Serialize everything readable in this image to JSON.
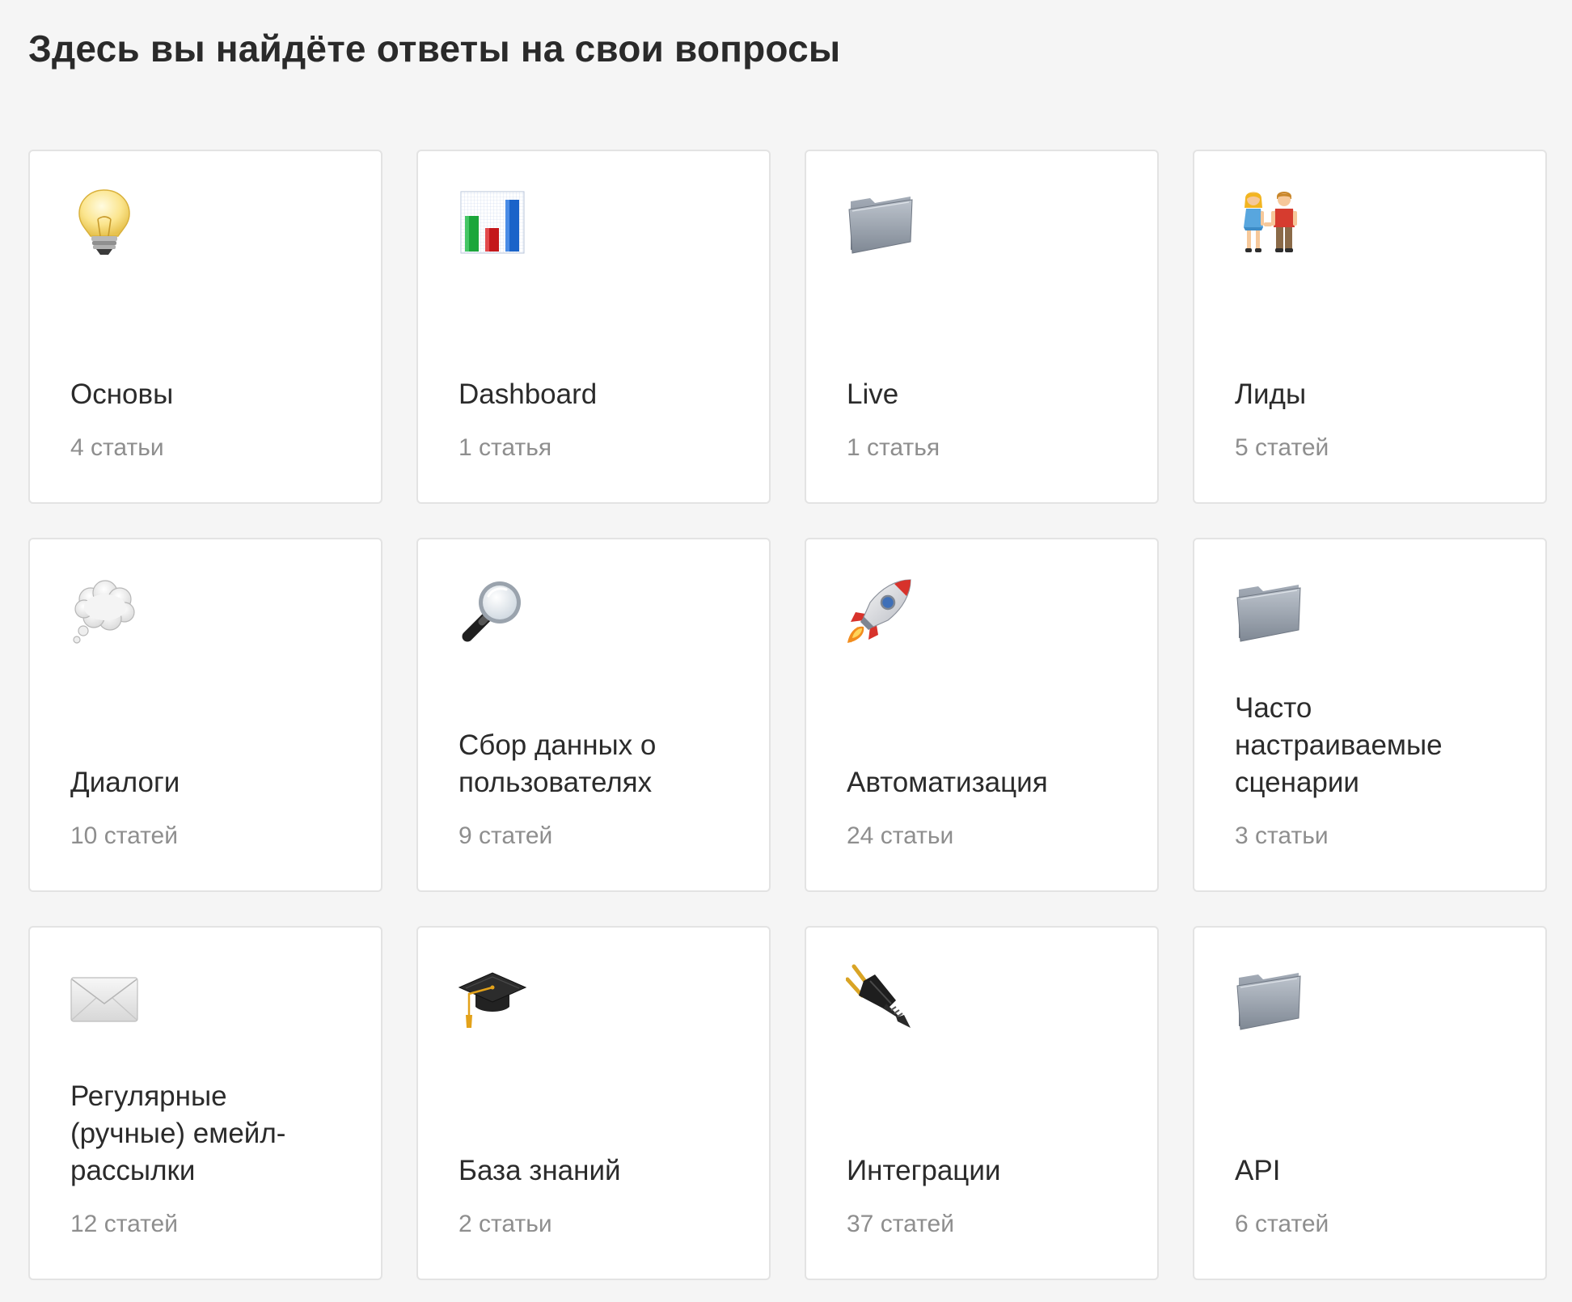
{
  "header": {
    "title": "Здесь вы найдёте ответы на свои вопросы"
  },
  "categories": [
    {
      "icon": "lightbulb-icon",
      "title": "Основы",
      "count": "4 статьи"
    },
    {
      "icon": "bar-chart-icon",
      "title": "Dashboard",
      "count": "1 статья"
    },
    {
      "icon": "folder-icon",
      "title": "Live",
      "count": "1 статья"
    },
    {
      "icon": "couple-icon",
      "title": "Лиды",
      "count": "5 статей"
    },
    {
      "icon": "thought-bubble-icon",
      "title": "Диалоги",
      "count": "10 статей"
    },
    {
      "icon": "magnifier-icon",
      "title": "Сбор данных о пользователях",
      "count": "9 статей"
    },
    {
      "icon": "rocket-icon",
      "title": "Автоматизация",
      "count": "24 статьи"
    },
    {
      "icon": "folder-icon",
      "title": "Часто настраиваемые сценарии",
      "count": "3 статьи"
    },
    {
      "icon": "envelope-icon",
      "title": "Регулярные (ручные) емейл-рассылки",
      "count": "12 статей"
    },
    {
      "icon": "graduation-cap-icon",
      "title": "База знаний",
      "count": "2 статьи"
    },
    {
      "icon": "plug-icon",
      "title": "Интеграции",
      "count": "37 статей"
    },
    {
      "icon": "folder-icon",
      "title": "API",
      "count": "6 статей"
    }
  ]
}
